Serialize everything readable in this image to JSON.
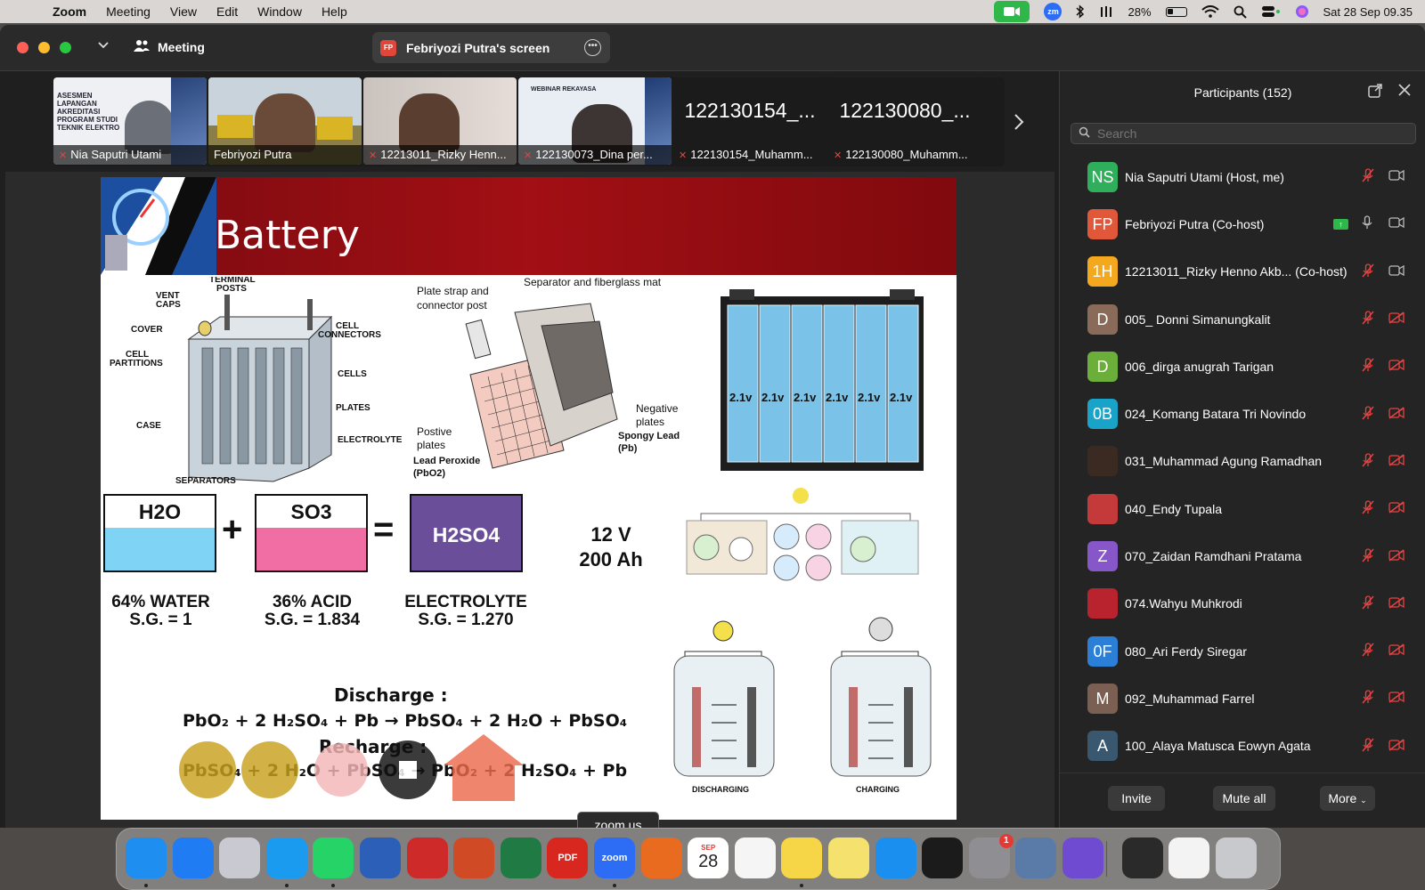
{
  "menubar": {
    "app": "Zoom",
    "items": [
      "Meeting",
      "View",
      "Edit",
      "Window",
      "Help"
    ],
    "battery": "28%",
    "datetime": "Sat 28 Sep  09.35"
  },
  "titlebar": {
    "meeting_label": "Meeting",
    "share_initials": "FP",
    "share_label": "Febriyozi Putra's screen"
  },
  "thumbnails": [
    {
      "name": "Nia Saputri Utami",
      "muted": true
    },
    {
      "name": "Febriyozi Putra",
      "muted": false,
      "active": true
    },
    {
      "name": "12213011_Rizky Henn...",
      "muted": true
    },
    {
      "name": "122130073_Dina per...",
      "muted": true
    },
    {
      "name": "122130154_Muhamm...",
      "big": "122130154_...",
      "muted": true
    },
    {
      "name": "122130080_Muhamm...",
      "big": "122130080_...",
      "muted": true
    }
  ],
  "slide": {
    "title": "Battery",
    "battery_labels": [
      "VENT CAPS",
      "TERMINAL POSTS",
      "COVER",
      "CELL CONNECTORS",
      "CELL PARTITIONS",
      "CELLS",
      "PLATES",
      "CASE",
      "ELECTROLYTE",
      "SEPARATORS"
    ],
    "plate_labels": [
      "Plate strap and connector post",
      "Separator and fiberglass mat",
      "Negative plates",
      "Spongy Lead (Pb)",
      "Postive plates",
      "Lead Peroxide (PbO2)"
    ],
    "cell_voltage": "2.1v",
    "boxes": [
      "H2O",
      "SO3",
      "H2SO4"
    ],
    "plus": "+",
    "equals": "=",
    "captions": [
      {
        "l1": "64% WATER",
        "l2": "S.G. = 1"
      },
      {
        "l1": "36% ACID",
        "l2": "S.G. = 1.834"
      },
      {
        "l1": "ELECTROLYTE",
        "l2": "S.G. = 1.270"
      }
    ],
    "voltage": "12 V",
    "capacity": "200 Ah",
    "discharge_title": "Discharge :",
    "discharge_eq": "PbO₂ + 2 H₂SO₄ + Pb → PbSO₄ + 2 H₂O + PbSO₄",
    "recharge_title": "Recharge :",
    "recharge_eq": "PbSO₄ + 2 H₂O + PbSO₄ → PbO₂ + 2 H₂SO₄ + Pb",
    "discharging": "DISCHARGING",
    "charging": "CHARGING"
  },
  "tooltip": "zoom.us",
  "participants": {
    "title": "Participants (152)",
    "search_placeholder": "Search",
    "list": [
      {
        "initials": "NS",
        "name": "Nia Saputri Utami (Host, me)",
        "color": "#2fae5b",
        "mic": "muted",
        "cam": "on"
      },
      {
        "initials": "FP",
        "name": "Febriyozi Putra (Co-host)",
        "color": "#e0573a",
        "mic": "on",
        "cam": "on",
        "sharing": true
      },
      {
        "initials": "1H",
        "name": "12213011_Rizky Henno Akb... (Co-host)",
        "color": "#f3a81e",
        "mic": "muted",
        "cam": "on"
      },
      {
        "initials": "D",
        "name": "005_ Donni Simanungkalit",
        "color": "#8a6b5a",
        "mic": "muted",
        "cam": "off"
      },
      {
        "initials": "D",
        "name": "006_dirga anugrah Tarigan",
        "color": "#6cae3a",
        "mic": "muted",
        "cam": "off"
      },
      {
        "initials": "0B",
        "name": "024_Komang Batara Tri Novindo",
        "color": "#1aa3c9",
        "mic": "muted",
        "cam": "off"
      },
      {
        "initials": "",
        "name": "031_Muhammad Agung Ramadhan",
        "color": "#3b2a22",
        "mic": "muted",
        "cam": "off"
      },
      {
        "initials": "",
        "name": "040_Endy Tupala",
        "color": "#c43a3a",
        "mic": "muted",
        "cam": "off"
      },
      {
        "initials": "Z",
        "name": "070_Zaidan Ramdhani Pratama",
        "color": "#8757c9",
        "mic": "muted",
        "cam": "off"
      },
      {
        "initials": "",
        "name": "074.Wahyu Muhkrodi",
        "color": "#b8232d",
        "mic": "muted",
        "cam": "off"
      },
      {
        "initials": "0F",
        "name": "080_Ari Ferdy Siregar",
        "color": "#2b7fd6",
        "mic": "muted",
        "cam": "off"
      },
      {
        "initials": "M",
        "name": "092_Muhammad Farrel",
        "color": "#7a5f52",
        "mic": "muted",
        "cam": "off"
      },
      {
        "initials": "A",
        "name": "100_Alaya Matusca Eowyn Agata",
        "color": "#3a5770",
        "mic": "muted",
        "cam": "off"
      }
    ],
    "invite": "Invite",
    "mute_all": "Mute all",
    "more": "More"
  },
  "dock": {
    "items": [
      {
        "name": "Finder",
        "color": "#1e8ff0",
        "running": true
      },
      {
        "name": "App Store",
        "color": "#1f7cf2",
        "running": false
      },
      {
        "name": "Launchpad",
        "color": "#c9c9d1",
        "running": false
      },
      {
        "name": "Safari",
        "color": "#1a9bf0",
        "running": true
      },
      {
        "name": "WhatsApp",
        "color": "#25d366",
        "running": true
      },
      {
        "name": "Word",
        "color": "#2b5fb8",
        "running": false
      },
      {
        "name": "Zotero",
        "color": "#cf2a2a",
        "running": false
      },
      {
        "name": "PowerPoint",
        "color": "#d04a26",
        "running": false
      },
      {
        "name": "Excel",
        "color": "#1f7a44",
        "running": false
      },
      {
        "name": "PDF",
        "color": "#d8271f",
        "running": false
      },
      {
        "name": "zoom",
        "color": "#2d6df6",
        "running": true
      },
      {
        "name": "MATLAB",
        "color": "#e86b1f",
        "running": false
      },
      {
        "name": "Calendar",
        "color": "#ffffff",
        "running": false
      },
      {
        "name": "Reminders",
        "color": "#f5f5f5",
        "running": false
      },
      {
        "name": "Notes",
        "color": "#f6d547",
        "running": true
      },
      {
        "name": "Stickies",
        "color": "#f4e16e",
        "running": false
      },
      {
        "name": "Keynote",
        "color": "#1a8ff0",
        "running": false
      },
      {
        "name": "Activity",
        "color": "#1b1b1b",
        "running": false
      },
      {
        "name": "Settings",
        "color": "#8e8e93",
        "running": false,
        "badge": "1"
      },
      {
        "name": "Preview",
        "color": "#5a7aa8",
        "running": false
      },
      {
        "name": "iMovie",
        "color": "#6e4bd1",
        "running": false
      },
      {
        "name": "QuickTime",
        "color": "#2a2a2a",
        "running": false
      },
      {
        "name": "TextEdit",
        "color": "#f3f3f3",
        "running": false
      },
      {
        "name": "Trash",
        "color": "#c7c9cc",
        "running": false
      }
    ],
    "calendar_month": "SEP",
    "calendar_day": "28",
    "zoom_label": "zoom",
    "pdf_label": "PDF"
  }
}
